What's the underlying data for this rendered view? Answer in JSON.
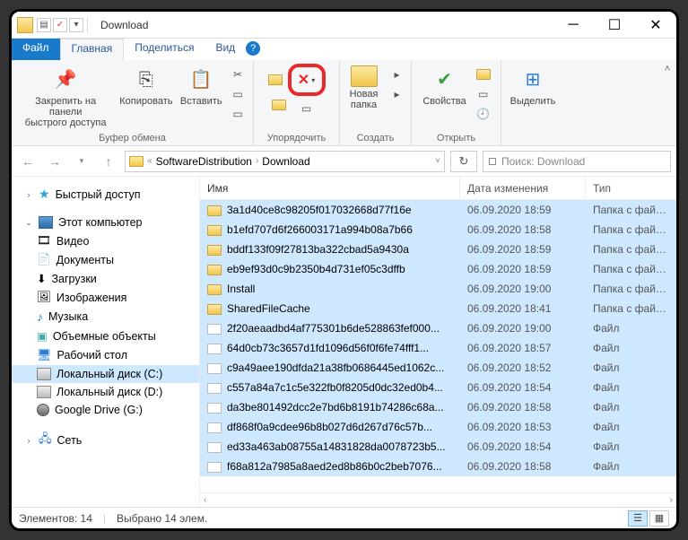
{
  "window": {
    "title": "Download"
  },
  "tabs": {
    "file": "Файл",
    "home": "Главная",
    "share": "Поделиться",
    "view": "Вид"
  },
  "ribbon": {
    "pin": "Закрепить на панели\nбыстрого доступа",
    "copy": "Копировать",
    "paste": "Вставить",
    "clipboard_group": "Буфер обмена",
    "organize_group": "Упорядочить",
    "newfolder": "Новая\nпапка",
    "create_group": "Создать",
    "properties": "Свойства",
    "open_group": "Открыть",
    "select": "Выделить",
    "delete_arrow": "▾"
  },
  "address": {
    "crumb1": "SoftwareDistribution",
    "crumb2": "Download",
    "search_placeholder": "Поиск: Download"
  },
  "nav": {
    "quick": "Быстрый доступ",
    "thispc": "Этот компьютер",
    "video": "Видео",
    "docs": "Документы",
    "downloads": "Загрузки",
    "pictures": "Изображения",
    "music": "Музыка",
    "volumes": "Объемные объекты",
    "desktop": "Рабочий стол",
    "cdrive": "Локальный диск (C:)",
    "ddrive": "Локальный диск (D:)",
    "gdrive": "Google Drive (G:)",
    "network": "Сеть"
  },
  "columns": {
    "name": "Имя",
    "modified": "Дата изменения",
    "type": "Тип"
  },
  "type_folder": "Папка с файлами",
  "type_file": "Файл",
  "files": [
    {
      "name": "3a1d40ce8c98205f017032668d77f16e",
      "date": "06.09.2020 18:59",
      "kind": "folder"
    },
    {
      "name": "b1efd707d6f266003171a994b08a7b66",
      "date": "06.09.2020 18:58",
      "kind": "folder"
    },
    {
      "name": "bddf133f09f27813ba322cbad5a9430a",
      "date": "06.09.2020 18:59",
      "kind": "folder"
    },
    {
      "name": "eb9ef93d0c9b2350b4d731ef05c3dffb",
      "date": "06.09.2020 18:59",
      "kind": "folder"
    },
    {
      "name": "Install",
      "date": "06.09.2020 19:00",
      "kind": "folder"
    },
    {
      "name": "SharedFileCache",
      "date": "06.09.2020 18:41",
      "kind": "folder"
    },
    {
      "name": "2f20aeaadbd4af775301b6de528863fef000...",
      "date": "06.09.2020 19:00",
      "kind": "file"
    },
    {
      "name": "64d0cb73c3657d1fd1096d56f0f6fe74fff1...",
      "date": "06.09.2020 18:57",
      "kind": "file"
    },
    {
      "name": "c9a49aee190dfda21a38fb0686445ed1062c...",
      "date": "06.09.2020 18:52",
      "kind": "file"
    },
    {
      "name": "c557a84a7c1c5e322fb0f8205d0dc32ed0b4...",
      "date": "06.09.2020 18:54",
      "kind": "file"
    },
    {
      "name": "da3be801492dcc2e7bd6b8191b74286c68a...",
      "date": "06.09.2020 18:58",
      "kind": "file"
    },
    {
      "name": "df868f0a9cdee96b8b027d6d267d76c57b...",
      "date": "06.09.2020 18:53",
      "kind": "file"
    },
    {
      "name": "ed33a463ab08755a14831828da0078723b5...",
      "date": "06.09.2020 18:54",
      "kind": "file"
    },
    {
      "name": "f68a812a7985a8aed2ed8b86b0c2beb7076...",
      "date": "06.09.2020 18:58",
      "kind": "file"
    }
  ],
  "status": {
    "items": "Элементов: 14",
    "selected": "Выбрано 14 элем."
  }
}
